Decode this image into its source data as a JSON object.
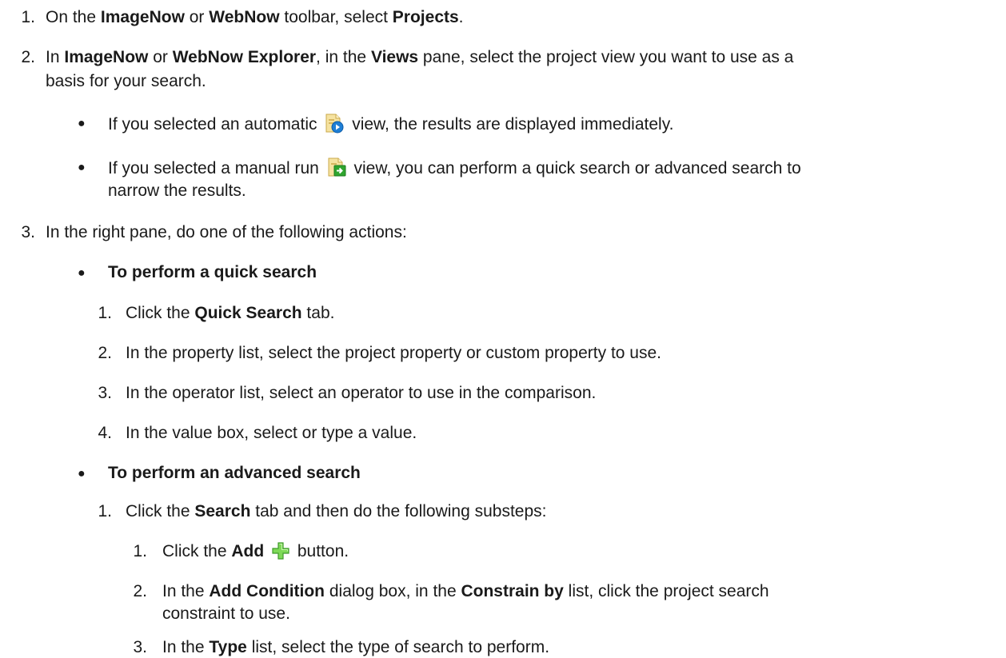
{
  "steps": {
    "s1": {
      "num": "1.",
      "t1": "On the ",
      "b1": "ImageNow",
      "t2": " or ",
      "b2": "WebNow",
      "t3": " toolbar, select ",
      "b3": "Projects",
      "t4": "."
    },
    "s2": {
      "num": "2.",
      "t1": "In ",
      "b1": "ImageNow",
      "t2": " or ",
      "b2": "WebNow Explorer",
      "t3": ", in the ",
      "b3": "Views",
      "t4": " pane, select the project view you want to use as a",
      "line2": "basis for your search.",
      "bullet_a": {
        "t1": "If you selected an automatic",
        "t2": "view, the results are displayed immediately."
      },
      "bullet_b": {
        "t1": "If you selected a manual run",
        "t2": "view, you can perform a quick search or advanced search to",
        "line2": "narrow the results."
      }
    },
    "s3": {
      "num": "3.",
      "text": "In the right pane, do one of the following actions:",
      "quick": {
        "heading": "To perform a quick search",
        "sub1": {
          "num": "1.",
          "t1": "Click the ",
          "b1": "Quick Search",
          "t2": " tab."
        },
        "sub2": {
          "num": "2.",
          "text": "In the property list, select the project property or custom property to use."
        },
        "sub3": {
          "num": "3.",
          "text": "In the operator list, select an operator to use in the comparison."
        },
        "sub4": {
          "num": "4.",
          "text": "In the value box, select or type a value."
        }
      },
      "advanced": {
        "heading": "To perform an advanced search",
        "sub1": {
          "num": "1.",
          "t1": "Click the ",
          "b1": "Search",
          "t2": " tab and then do the following substeps:",
          "a": {
            "num": "1.",
            "t1": "Click the ",
            "b1": "Add",
            "t2": " button."
          },
          "b": {
            "num": "2.",
            "t1": "In the ",
            "b1": "Add Condition",
            "t2": " dialog box, in the ",
            "b2": "Constrain by",
            "t3": " list, click the project search",
            "line2": "constraint to use."
          },
          "c": {
            "num": "3.",
            "t1": "In the ",
            "b1": "Type",
            "t2": " list, select the type of search to perform."
          }
        }
      }
    }
  },
  "icons": {
    "automatic_view": "automatic-view-icon",
    "manual_run_view": "manual-run-view-icon",
    "add": "add-plus-icon"
  }
}
